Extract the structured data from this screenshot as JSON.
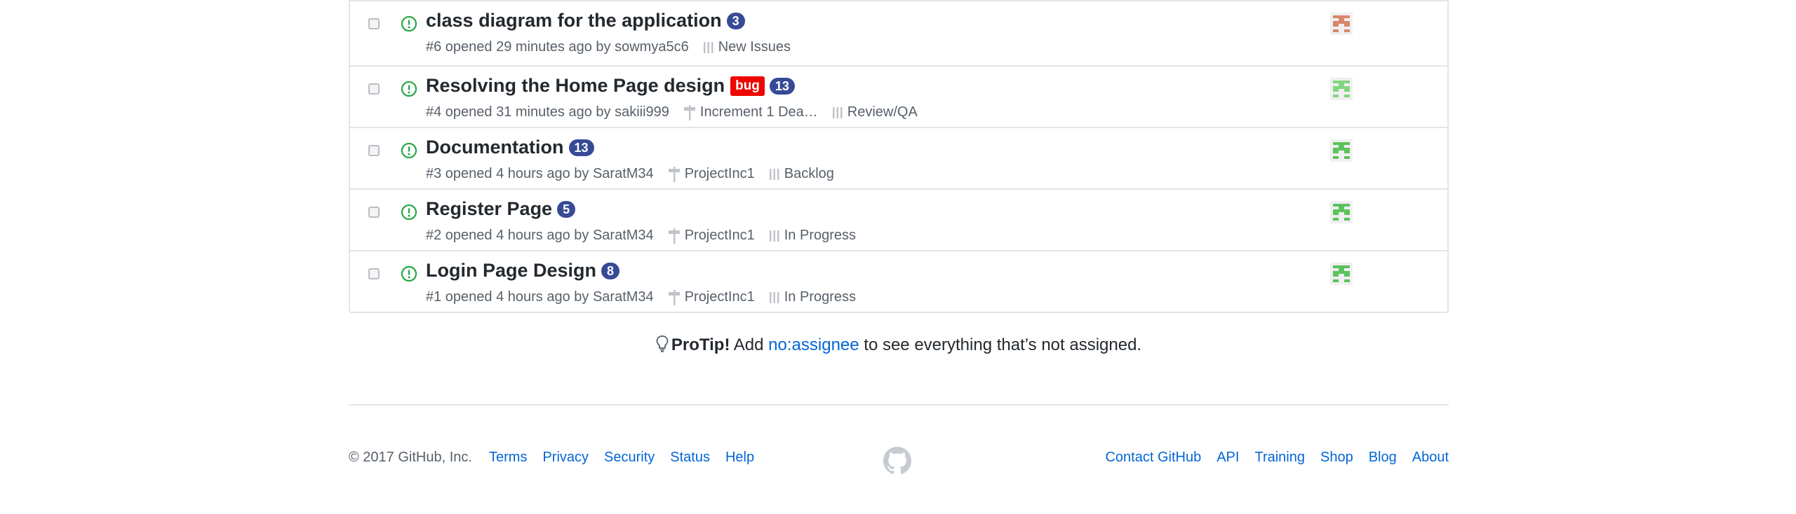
{
  "issues": [
    {
      "title": "class diagram for the application",
      "comments": "3",
      "labels": [],
      "meta": "#6 opened 29 minutes ago by sowmya5c6",
      "milestone": "",
      "project": "New Issues",
      "avatar_color": "#d9866a"
    },
    {
      "title": "Resolving the Home Page design",
      "comments": "13",
      "labels": [
        "bug"
      ],
      "meta": "#4 opened 31 minutes ago by sakiii999",
      "milestone": "Increment 1 Dea…",
      "project": "Review/QA",
      "avatar_color": "#7fd67f"
    },
    {
      "title": "Documentation",
      "comments": "13",
      "labels": [],
      "meta": "#3 opened 4 hours ago by SaratM34",
      "milestone": "ProjectInc1",
      "project": "Backlog",
      "avatar_color": "#5cc35c"
    },
    {
      "title": "Register Page",
      "comments": "5",
      "labels": [],
      "meta": "#2 opened 4 hours ago by SaratM34",
      "milestone": "ProjectInc1",
      "project": "In Progress",
      "avatar_color": "#5cc35c"
    },
    {
      "title": "Login Page Design",
      "comments": "8",
      "labels": [],
      "meta": "#1 opened 4 hours ago by SaratM34",
      "milestone": "ProjectInc1",
      "project": "In Progress",
      "avatar_color": "#5cc35c"
    }
  ],
  "protip": {
    "lead": "ProTip!",
    "before": " Add ",
    "link": "no:assignee",
    "after": " to see everything that’s not assigned."
  },
  "footer": {
    "copyright": "© 2017 GitHub, Inc.",
    "left_links": [
      "Terms",
      "Privacy",
      "Security",
      "Status",
      "Help"
    ],
    "right_links": [
      "Contact GitHub",
      "API",
      "Training",
      "Shop",
      "Blog",
      "About"
    ]
  },
  "colors": {
    "open": "#28a745",
    "bug_label": "#ee0701",
    "counter": "#364a96",
    "link": "#0366d6"
  }
}
